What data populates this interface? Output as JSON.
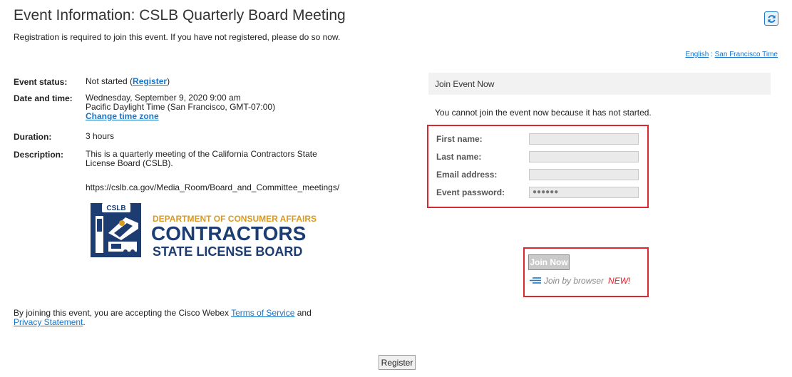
{
  "header": {
    "title": "Event Information: CSLB Quarterly Board Meeting",
    "subtitle": "Registration is required to join this event. If you have not registered, please do so now.",
    "refresh_icon": "refresh-icon",
    "language": "English",
    "separator": ":",
    "timezone": "San Francisco Time"
  },
  "event": {
    "status_label": "Event status:",
    "status_value": "Not started",
    "register_link": "Register",
    "datetime_label": "Date and time:",
    "datetime_line1": "Wednesday, September 9, 2020 9:00 am",
    "datetime_line2": "Pacific Daylight Time (San Francisco, GMT-07:00)",
    "change_tz_link": "Change time zone",
    "duration_label": "Duration:",
    "duration_value": "3 hours",
    "description_label": "Description:",
    "description_line1": "This is a quarterly meeting of the California Contractors State",
    "description_line2": "License Board (CSLB).",
    "description_url": "https://cslb.ca.gov/Media_Room/Board_and_Committee_meetings/"
  },
  "logo": {
    "badge": "CSLB",
    "line1": "DEPARTMENT OF CONSUMER AFFAIRS",
    "line2": "CONTRACTORS",
    "line3": "STATE LICENSE BOARD",
    "color": "#1d3d72",
    "accent": "#d99a22"
  },
  "join": {
    "panel_title": "Join Event Now",
    "message": "You cannot join the event now because it has not started.",
    "fields": [
      {
        "label": "First name:",
        "value": ""
      },
      {
        "label": "Last name:",
        "value": ""
      },
      {
        "label": "Email address:",
        "value": ""
      },
      {
        "label": "Event password:",
        "value": "●●●●●●"
      }
    ],
    "join_now": "Join Now",
    "join_browser": "Join by browser",
    "new_badge": "NEW!"
  },
  "footer": {
    "tos_prefix": "By joining this event, you are accepting the Cisco Webex ",
    "tos_link": "Terms of Service",
    "tos_and": " and",
    "privacy_link": "Privacy Statement",
    "tos_end": ".",
    "register_button": "Register"
  }
}
